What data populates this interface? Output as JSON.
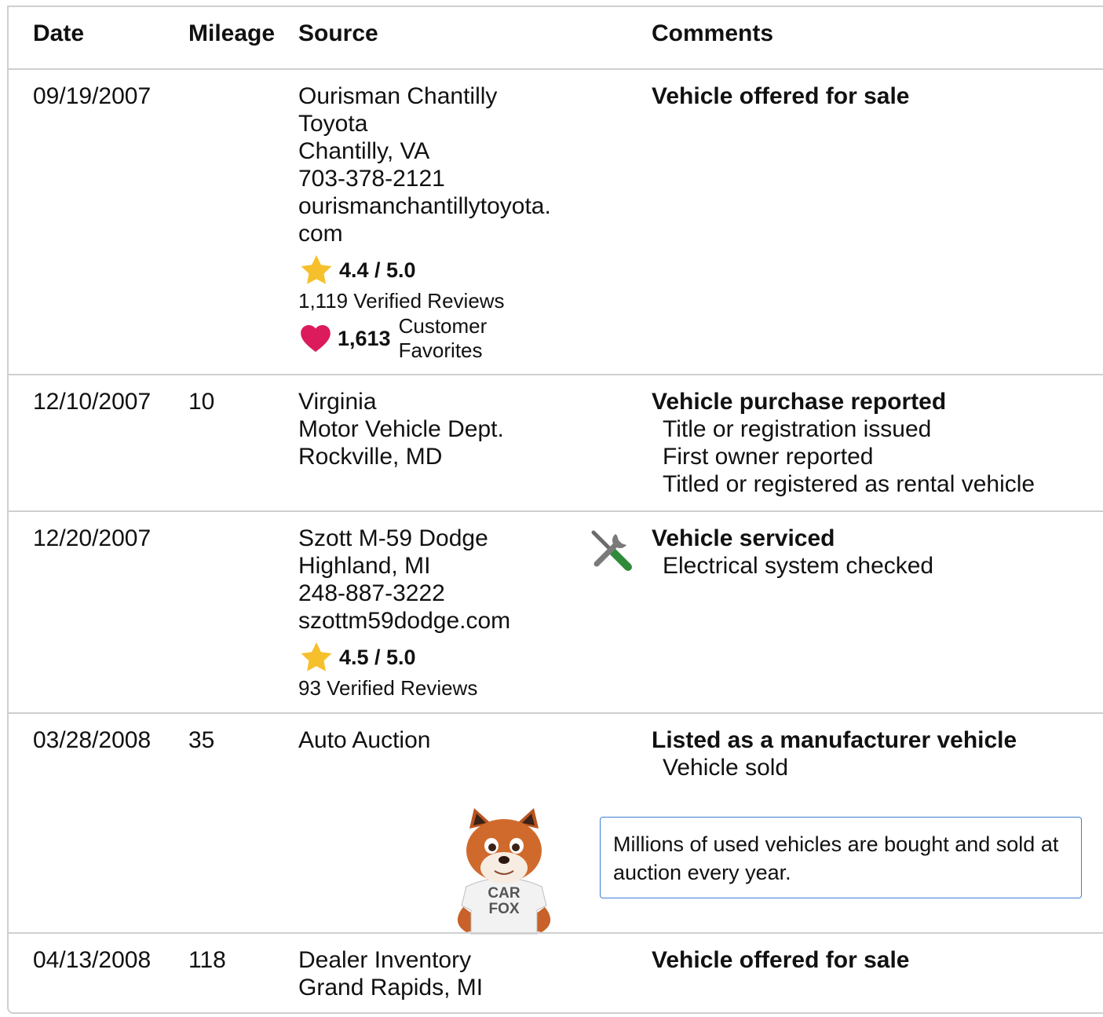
{
  "headers": {
    "date": "Date",
    "mileage": "Mileage",
    "source": "Source",
    "comments": "Comments"
  },
  "rows": [
    {
      "date": "09/19/2007",
      "mileage": "",
      "source": [
        "Ourisman Chantilly",
        "Toyota",
        "Chantilly, VA",
        "703-378-2121",
        "ourismanchantillytoyota.",
        "com"
      ],
      "rating": "4.4 / 5.0",
      "reviews": "1,119 Verified Reviews",
      "favorites_count": "1,613",
      "favorites_label": [
        "Customer",
        "Favorites"
      ],
      "comment_title": "Vehicle offered for sale",
      "comment_lines": []
    },
    {
      "date": "12/10/2007",
      "mileage": "10",
      "source": [
        "Virginia",
        "Motor Vehicle Dept.",
        "Rockville, MD"
      ],
      "comment_title": "Vehicle purchase reported",
      "comment_lines": [
        "Title or registration issued",
        "First owner reported",
        "Titled or registered as rental vehicle"
      ]
    },
    {
      "date": "12/20/2007",
      "mileage": "",
      "source": [
        "Szott M-59 Dodge",
        "Highland, MI",
        "248-887-3222",
        "szottm59dodge.com"
      ],
      "rating": "4.5 / 5.0",
      "reviews": "93 Verified Reviews",
      "icon": "service-tools-icon",
      "comment_title": "Vehicle serviced",
      "comment_lines": [
        "Electrical system checked"
      ]
    },
    {
      "date": "03/28/2008",
      "mileage": "35",
      "source": [
        "Auto Auction"
      ],
      "comment_title": "Listed as a manufacturer vehicle",
      "comment_lines": [
        "Vehicle sold"
      ],
      "tip": "Millions of used vehicles are bought and sold at auction every year.",
      "mascot_shirt": [
        "CAR",
        "FOX"
      ]
    },
    {
      "date": "04/13/2008",
      "mileage": "118",
      "source": [
        "Dealer Inventory",
        "Grand Rapids, MI"
      ],
      "comment_title": "Vehicle offered for sale",
      "comment_lines": []
    }
  ],
  "colors": {
    "star": "#f6c02c",
    "heart": "#dc1b5c",
    "tip_border": "#3b7fd3",
    "divider": "#cfcfcf",
    "wrench_handle": "#2e8b3a"
  }
}
